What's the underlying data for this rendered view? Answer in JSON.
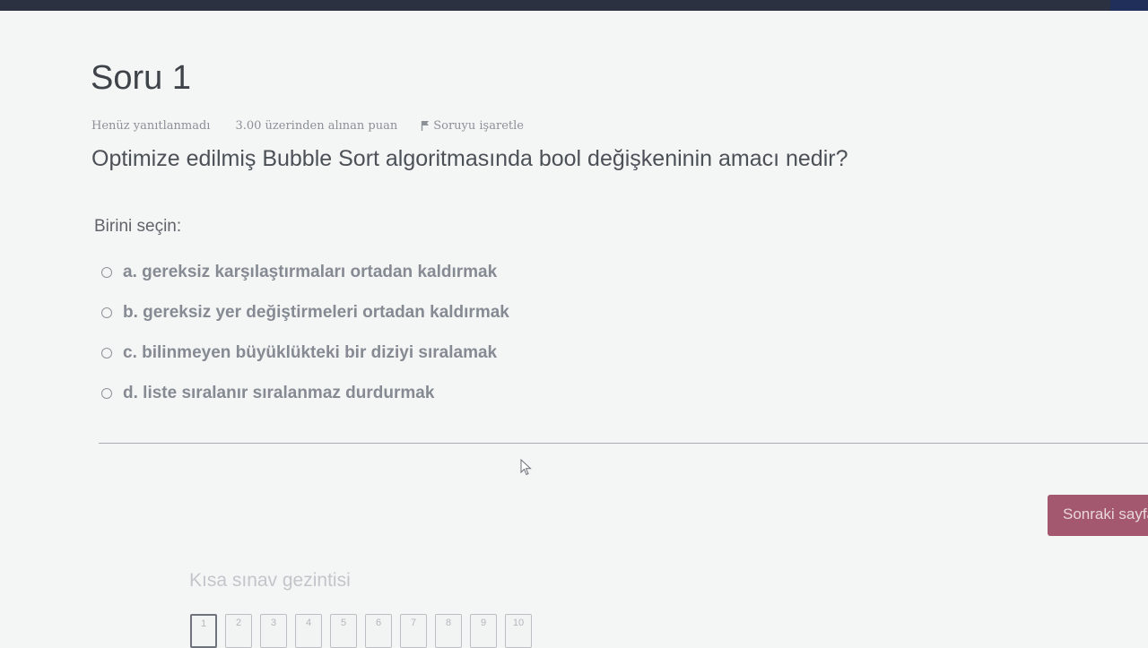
{
  "page": {
    "title": "Soru 1",
    "status": "Henüz yanıtlanmadı",
    "points": "3.00 üzerinden alınan puan",
    "flag_label": "Soruyu işaretle"
  },
  "question": {
    "text": "Optimize edilmiş Bubble Sort algoritmasında bool değişkeninin amacı nedir?",
    "prompt": "Birini seçin:",
    "answers": [
      {
        "label": "a. gereksiz karşılaştırmaları ortadan kaldırmak"
      },
      {
        "label": "b. gereksiz yer değiştirmeleri ortadan kaldırmak"
      },
      {
        "label": "c. bilinmeyen büyüklükteki bir diziyi sıralamak"
      },
      {
        "label": "d. liste sıralanır sıralanmaz durdurmak"
      }
    ]
  },
  "actions": {
    "next_label": "Sonraki sayfa"
  },
  "navigation": {
    "title": "Kısa sınav gezintisi",
    "items": [
      "1",
      "2",
      "3",
      "4",
      "5",
      "6",
      "7",
      "8",
      "9",
      "10"
    ],
    "current": "1"
  },
  "colors": {
    "accent": "#a3586f",
    "topbar": "#2b3140"
  },
  "icons": {
    "flag": "flag-icon",
    "cursor": "mouse-cursor-icon",
    "radio": "radio-icon"
  }
}
